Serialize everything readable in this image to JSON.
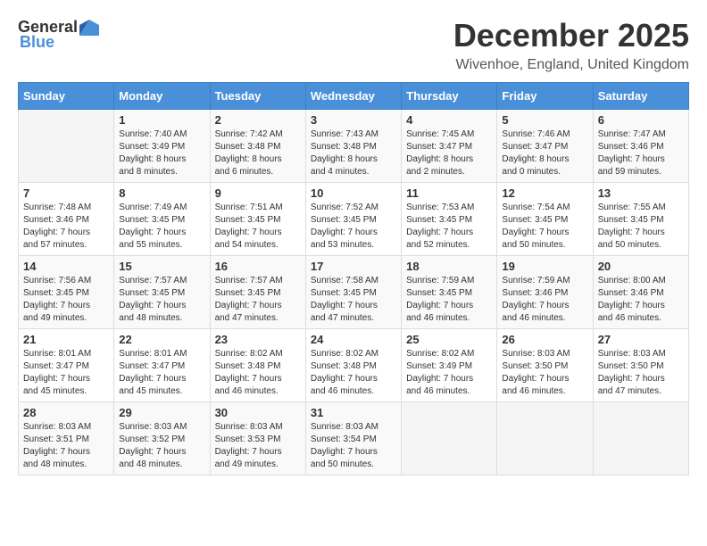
{
  "logo": {
    "general": "General",
    "blue": "Blue"
  },
  "header": {
    "month": "December 2025",
    "location": "Wivenhoe, England, United Kingdom"
  },
  "days_of_week": [
    "Sunday",
    "Monday",
    "Tuesday",
    "Wednesday",
    "Thursday",
    "Friday",
    "Saturday"
  ],
  "weeks": [
    [
      {
        "day": "",
        "info": ""
      },
      {
        "day": "1",
        "info": "Sunrise: 7:40 AM\nSunset: 3:49 PM\nDaylight: 8 hours\nand 8 minutes."
      },
      {
        "day": "2",
        "info": "Sunrise: 7:42 AM\nSunset: 3:48 PM\nDaylight: 8 hours\nand 6 minutes."
      },
      {
        "day": "3",
        "info": "Sunrise: 7:43 AM\nSunset: 3:48 PM\nDaylight: 8 hours\nand 4 minutes."
      },
      {
        "day": "4",
        "info": "Sunrise: 7:45 AM\nSunset: 3:47 PM\nDaylight: 8 hours\nand 2 minutes."
      },
      {
        "day": "5",
        "info": "Sunrise: 7:46 AM\nSunset: 3:47 PM\nDaylight: 8 hours\nand 0 minutes."
      },
      {
        "day": "6",
        "info": "Sunrise: 7:47 AM\nSunset: 3:46 PM\nDaylight: 7 hours\nand 59 minutes."
      }
    ],
    [
      {
        "day": "7",
        "info": "Sunrise: 7:48 AM\nSunset: 3:46 PM\nDaylight: 7 hours\nand 57 minutes."
      },
      {
        "day": "8",
        "info": "Sunrise: 7:49 AM\nSunset: 3:45 PM\nDaylight: 7 hours\nand 55 minutes."
      },
      {
        "day": "9",
        "info": "Sunrise: 7:51 AM\nSunset: 3:45 PM\nDaylight: 7 hours\nand 54 minutes."
      },
      {
        "day": "10",
        "info": "Sunrise: 7:52 AM\nSunset: 3:45 PM\nDaylight: 7 hours\nand 53 minutes."
      },
      {
        "day": "11",
        "info": "Sunrise: 7:53 AM\nSunset: 3:45 PM\nDaylight: 7 hours\nand 52 minutes."
      },
      {
        "day": "12",
        "info": "Sunrise: 7:54 AM\nSunset: 3:45 PM\nDaylight: 7 hours\nand 50 minutes."
      },
      {
        "day": "13",
        "info": "Sunrise: 7:55 AM\nSunset: 3:45 PM\nDaylight: 7 hours\nand 50 minutes."
      }
    ],
    [
      {
        "day": "14",
        "info": "Sunrise: 7:56 AM\nSunset: 3:45 PM\nDaylight: 7 hours\nand 49 minutes."
      },
      {
        "day": "15",
        "info": "Sunrise: 7:57 AM\nSunset: 3:45 PM\nDaylight: 7 hours\nand 48 minutes."
      },
      {
        "day": "16",
        "info": "Sunrise: 7:57 AM\nSunset: 3:45 PM\nDaylight: 7 hours\nand 47 minutes."
      },
      {
        "day": "17",
        "info": "Sunrise: 7:58 AM\nSunset: 3:45 PM\nDaylight: 7 hours\nand 47 minutes."
      },
      {
        "day": "18",
        "info": "Sunrise: 7:59 AM\nSunset: 3:45 PM\nDaylight: 7 hours\nand 46 minutes."
      },
      {
        "day": "19",
        "info": "Sunrise: 7:59 AM\nSunset: 3:46 PM\nDaylight: 7 hours\nand 46 minutes."
      },
      {
        "day": "20",
        "info": "Sunrise: 8:00 AM\nSunset: 3:46 PM\nDaylight: 7 hours\nand 46 minutes."
      }
    ],
    [
      {
        "day": "21",
        "info": "Sunrise: 8:01 AM\nSunset: 3:47 PM\nDaylight: 7 hours\nand 45 minutes."
      },
      {
        "day": "22",
        "info": "Sunrise: 8:01 AM\nSunset: 3:47 PM\nDaylight: 7 hours\nand 45 minutes."
      },
      {
        "day": "23",
        "info": "Sunrise: 8:02 AM\nSunset: 3:48 PM\nDaylight: 7 hours\nand 46 minutes."
      },
      {
        "day": "24",
        "info": "Sunrise: 8:02 AM\nSunset: 3:48 PM\nDaylight: 7 hours\nand 46 minutes."
      },
      {
        "day": "25",
        "info": "Sunrise: 8:02 AM\nSunset: 3:49 PM\nDaylight: 7 hours\nand 46 minutes."
      },
      {
        "day": "26",
        "info": "Sunrise: 8:03 AM\nSunset: 3:50 PM\nDaylight: 7 hours\nand 46 minutes."
      },
      {
        "day": "27",
        "info": "Sunrise: 8:03 AM\nSunset: 3:50 PM\nDaylight: 7 hours\nand 47 minutes."
      }
    ],
    [
      {
        "day": "28",
        "info": "Sunrise: 8:03 AM\nSunset: 3:51 PM\nDaylight: 7 hours\nand 48 minutes."
      },
      {
        "day": "29",
        "info": "Sunrise: 8:03 AM\nSunset: 3:52 PM\nDaylight: 7 hours\nand 48 minutes."
      },
      {
        "day": "30",
        "info": "Sunrise: 8:03 AM\nSunset: 3:53 PM\nDaylight: 7 hours\nand 49 minutes."
      },
      {
        "day": "31",
        "info": "Sunrise: 8:03 AM\nSunset: 3:54 PM\nDaylight: 7 hours\nand 50 minutes."
      },
      {
        "day": "",
        "info": ""
      },
      {
        "day": "",
        "info": ""
      },
      {
        "day": "",
        "info": ""
      }
    ]
  ]
}
